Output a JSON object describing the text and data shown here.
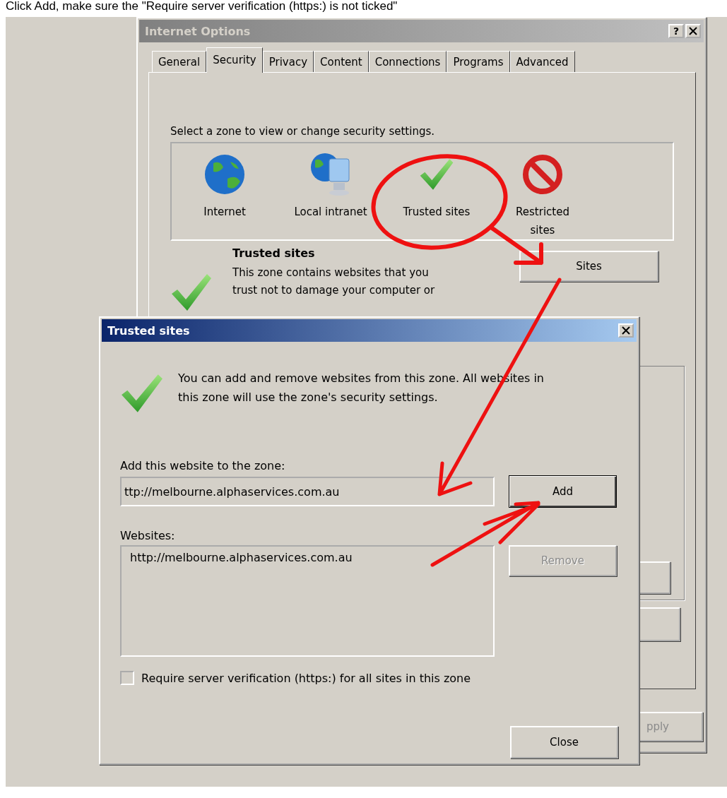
{
  "instruction": "Click Add, make sure the \"Require server verification (https:) is not ticked\"",
  "internet_options": {
    "title": "Internet Options",
    "help_button": "?",
    "tabs": [
      {
        "label": "General",
        "selected": false
      },
      {
        "label": "Security",
        "selected": true
      },
      {
        "label": "Privacy",
        "selected": false
      },
      {
        "label": "Content",
        "selected": false
      },
      {
        "label": "Connections",
        "selected": false
      },
      {
        "label": "Programs",
        "selected": false
      },
      {
        "label": "Advanced",
        "selected": false
      }
    ],
    "zone_prompt": "Select a zone to view or change security settings.",
    "zones": [
      {
        "label": "Internet",
        "kind": "globe"
      },
      {
        "label": "Local intranet",
        "kind": "intranet"
      },
      {
        "label": "Trusted sites",
        "kind": "trusted"
      },
      {
        "label": "Restricted\nsites",
        "kind": "restricted"
      }
    ],
    "zone_title": "Trusted sites",
    "zone_description": "This zone contains websites that you\ntrust not to damage your computer or",
    "sites_button": "Sites",
    "apply_button": "pply"
  },
  "trusted_sites_dialog": {
    "title": "Trusted sites",
    "description": "You can add and remove websites from this zone. All websites in\nthis zone will use the zone's security settings.",
    "add_label": "Add this website to the zone:",
    "add_value": "ttp://melbourne.alphaservices.com.au",
    "add_button": "Add",
    "websites_label": "Websites:",
    "websites": [
      "http://melbourne.alphaservices.com.au"
    ],
    "remove_button": {
      "label": "Remove",
      "disabled": true
    },
    "require_https": {
      "label": "Require server verification (https:) for all sites in this zone",
      "checked": false
    },
    "close_button": "Close"
  }
}
